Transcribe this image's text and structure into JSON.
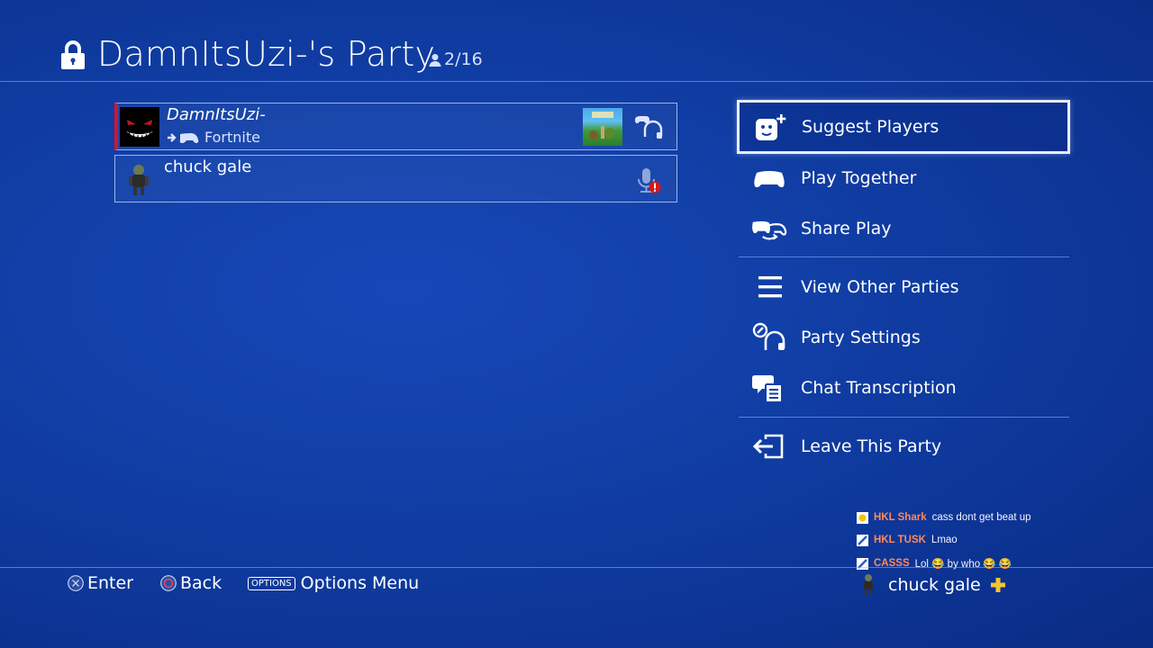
{
  "header": {
    "title": "DamnItsUzi-'s Party",
    "member_count": "2/16"
  },
  "members": [
    {
      "name": "DamnItsUzi-",
      "activity": "Fortnite",
      "game": "Fortnite"
    },
    {
      "name": "chuck gale"
    }
  ],
  "menu": {
    "group1": [
      {
        "label": "Suggest Players",
        "icon": "add-player-icon"
      },
      {
        "label": "Play Together",
        "icon": "controller-icon"
      },
      {
        "label": "Share Play",
        "icon": "share-play-icon"
      }
    ],
    "group2": [
      {
        "label": "View Other Parties",
        "icon": "list-icon"
      },
      {
        "label": "Party Settings",
        "icon": "settings-headset-icon"
      },
      {
        "label": "Chat Transcription",
        "icon": "chat-transcription-icon"
      }
    ],
    "group3": [
      {
        "label": "Leave This Party",
        "icon": "leave-icon"
      }
    ]
  },
  "notifications": [
    {
      "user": "HKL Shark",
      "message": "cass dont get beat up"
    },
    {
      "user": "HKL TUSK",
      "message": "Lmao"
    },
    {
      "user": "CASSS",
      "message": "Lol 😂 by who 😂 😂"
    }
  ],
  "footer": {
    "enter": "Enter",
    "back": "Back",
    "options_tag": "OPTIONS",
    "options": "Options Menu",
    "current_user": "chuck gale"
  },
  "colors": {
    "background": "#1140a8",
    "active_marker": "#d2152f",
    "notification_user": "#ff8a5a",
    "plus_gold": "#f4c430"
  }
}
